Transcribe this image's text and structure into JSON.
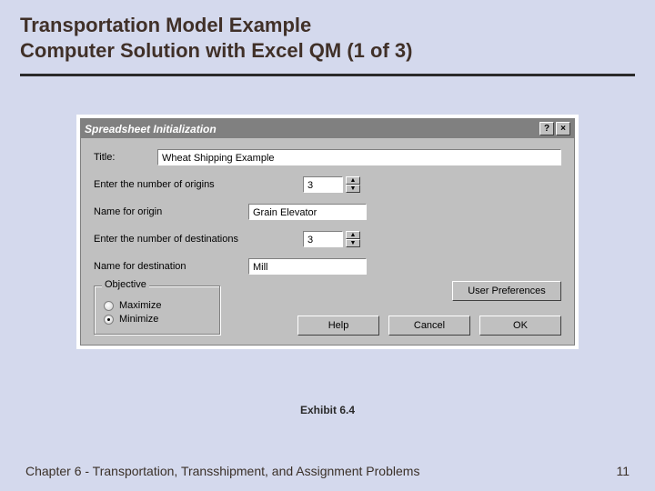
{
  "slide": {
    "title_line1": "Transportation Model Example",
    "title_line2": "Computer Solution with Excel QM (1 of 3)",
    "caption": "Exhibit 6.4",
    "footer": "Chapter 6 - Transportation, Transshipment, and Assignment Problems",
    "page": "11"
  },
  "dialog": {
    "titlebar": "Spreadsheet Initialization",
    "help_glyph": "?",
    "close_glyph": "×",
    "labels": {
      "title": "Title:",
      "origins": "Enter the number of origins",
      "origin_name": "Name for origin",
      "destinations": "Enter the number of destinations",
      "dest_name": "Name for destination"
    },
    "values": {
      "title": "Wheat Shipping Example",
      "origins": "3",
      "origin_name": "Grain Elevator",
      "destinations": "3",
      "dest_name": "Mill"
    },
    "objective": {
      "group": "Objective",
      "maximize": "Maximize",
      "minimize": "Minimize"
    },
    "buttons": {
      "userpref": "User Preferences",
      "help": "Help",
      "cancel": "Cancel",
      "ok": "OK"
    }
  }
}
